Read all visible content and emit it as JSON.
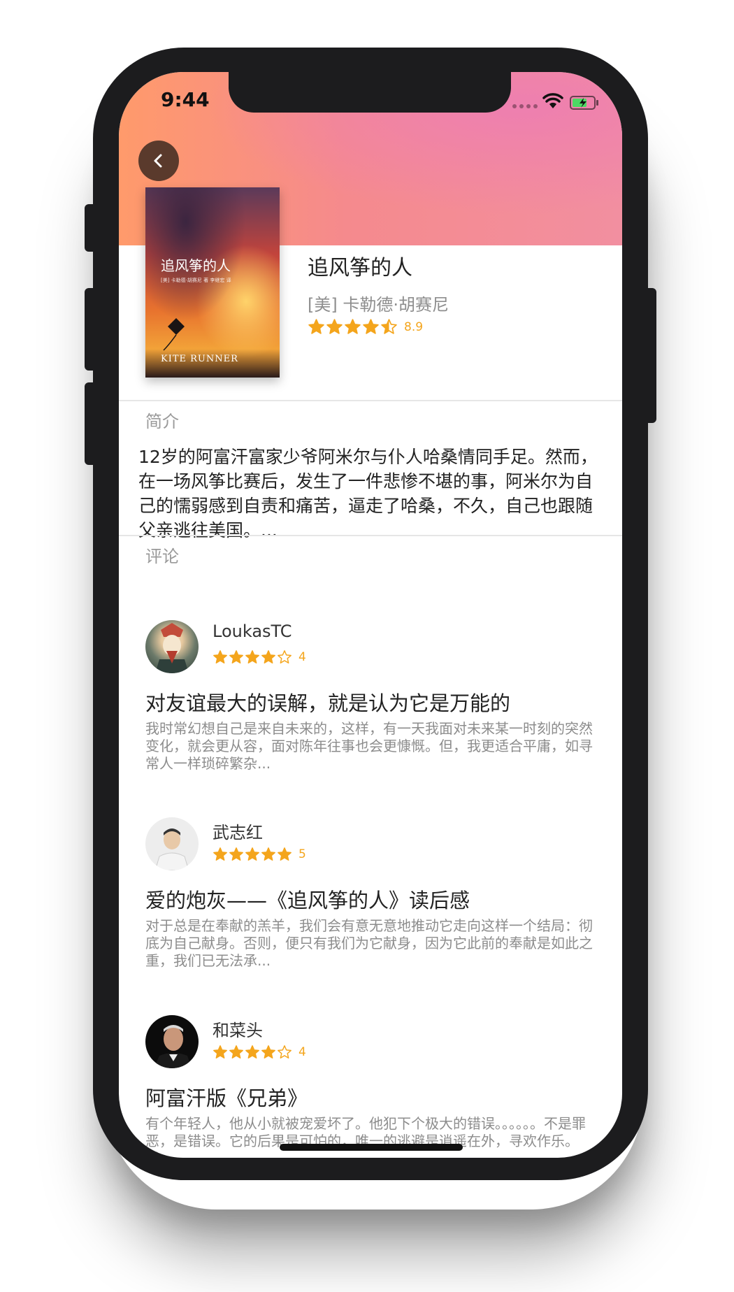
{
  "status_bar": {
    "time": "9:44"
  },
  "book": {
    "title": "追风筝的人",
    "author": "[美] 卡勒德·胡赛尼",
    "rating": 8.9,
    "rating_label": "8.9",
    "stars": 4.5,
    "cover": {
      "title": "追风筝的人",
      "subtitle": "[美] 卡勒德·胡赛尼 著  李继宏 译",
      "english": "KITE RUNNER"
    }
  },
  "intro": {
    "label": "简介",
    "text": "12岁的阿富汗富家少爷阿米尔与仆人哈桑情同手足。然而，在一场风筝比赛后，发生了一件悲惨不堪的事，阿米尔为自己的懦弱感到自责和痛苦，逼走了哈桑，不久，自己也跟随父亲逃往美国。..."
  },
  "reviews_label": "评论",
  "reviews": [
    {
      "name": "LoukasTC",
      "stars": 4,
      "score": "4",
      "title": "对友谊最大的误解，就是认为它是万能的",
      "body": "我时常幻想自己是来自未来的，这样，有一天我面对未来某一时刻的突然变化，就会更从容，面对陈年往事也会更慷慨。但，我更适合平庸，如寻常人一样琐碎繁杂..."
    },
    {
      "name": "武志红",
      "stars": 5,
      "score": "5",
      "title": "爱的炮灰——《追风筝的人》读后感",
      "body": "对于总是在奉献的羔羊，我们会有意无意地推动它走向这样一个结局：彻底为自己献身。否则，便只有我们为它献身，因为它此前的奉献是如此之重，我们已无法承..."
    },
    {
      "name": "和菜头",
      "stars": 4,
      "score": "4",
      "title": "阿富汗版《兄弟》",
      "body": "有个年轻人，他从小就被宠爱坏了。他犯下个极大的错误。。。。。。不是罪恶，是错误。它的后果是可怕的，唯一的逃避是逍遥在外，寻欢作乐。后..."
    }
  ],
  "colors": {
    "star": "#f4a51c",
    "hero_start": "#ff9a6b",
    "hero_end": "#f28fa0"
  },
  "icons": {
    "back": "chevron-left-icon",
    "wifi": "wifi-icon",
    "battery": "battery-charging-icon"
  }
}
